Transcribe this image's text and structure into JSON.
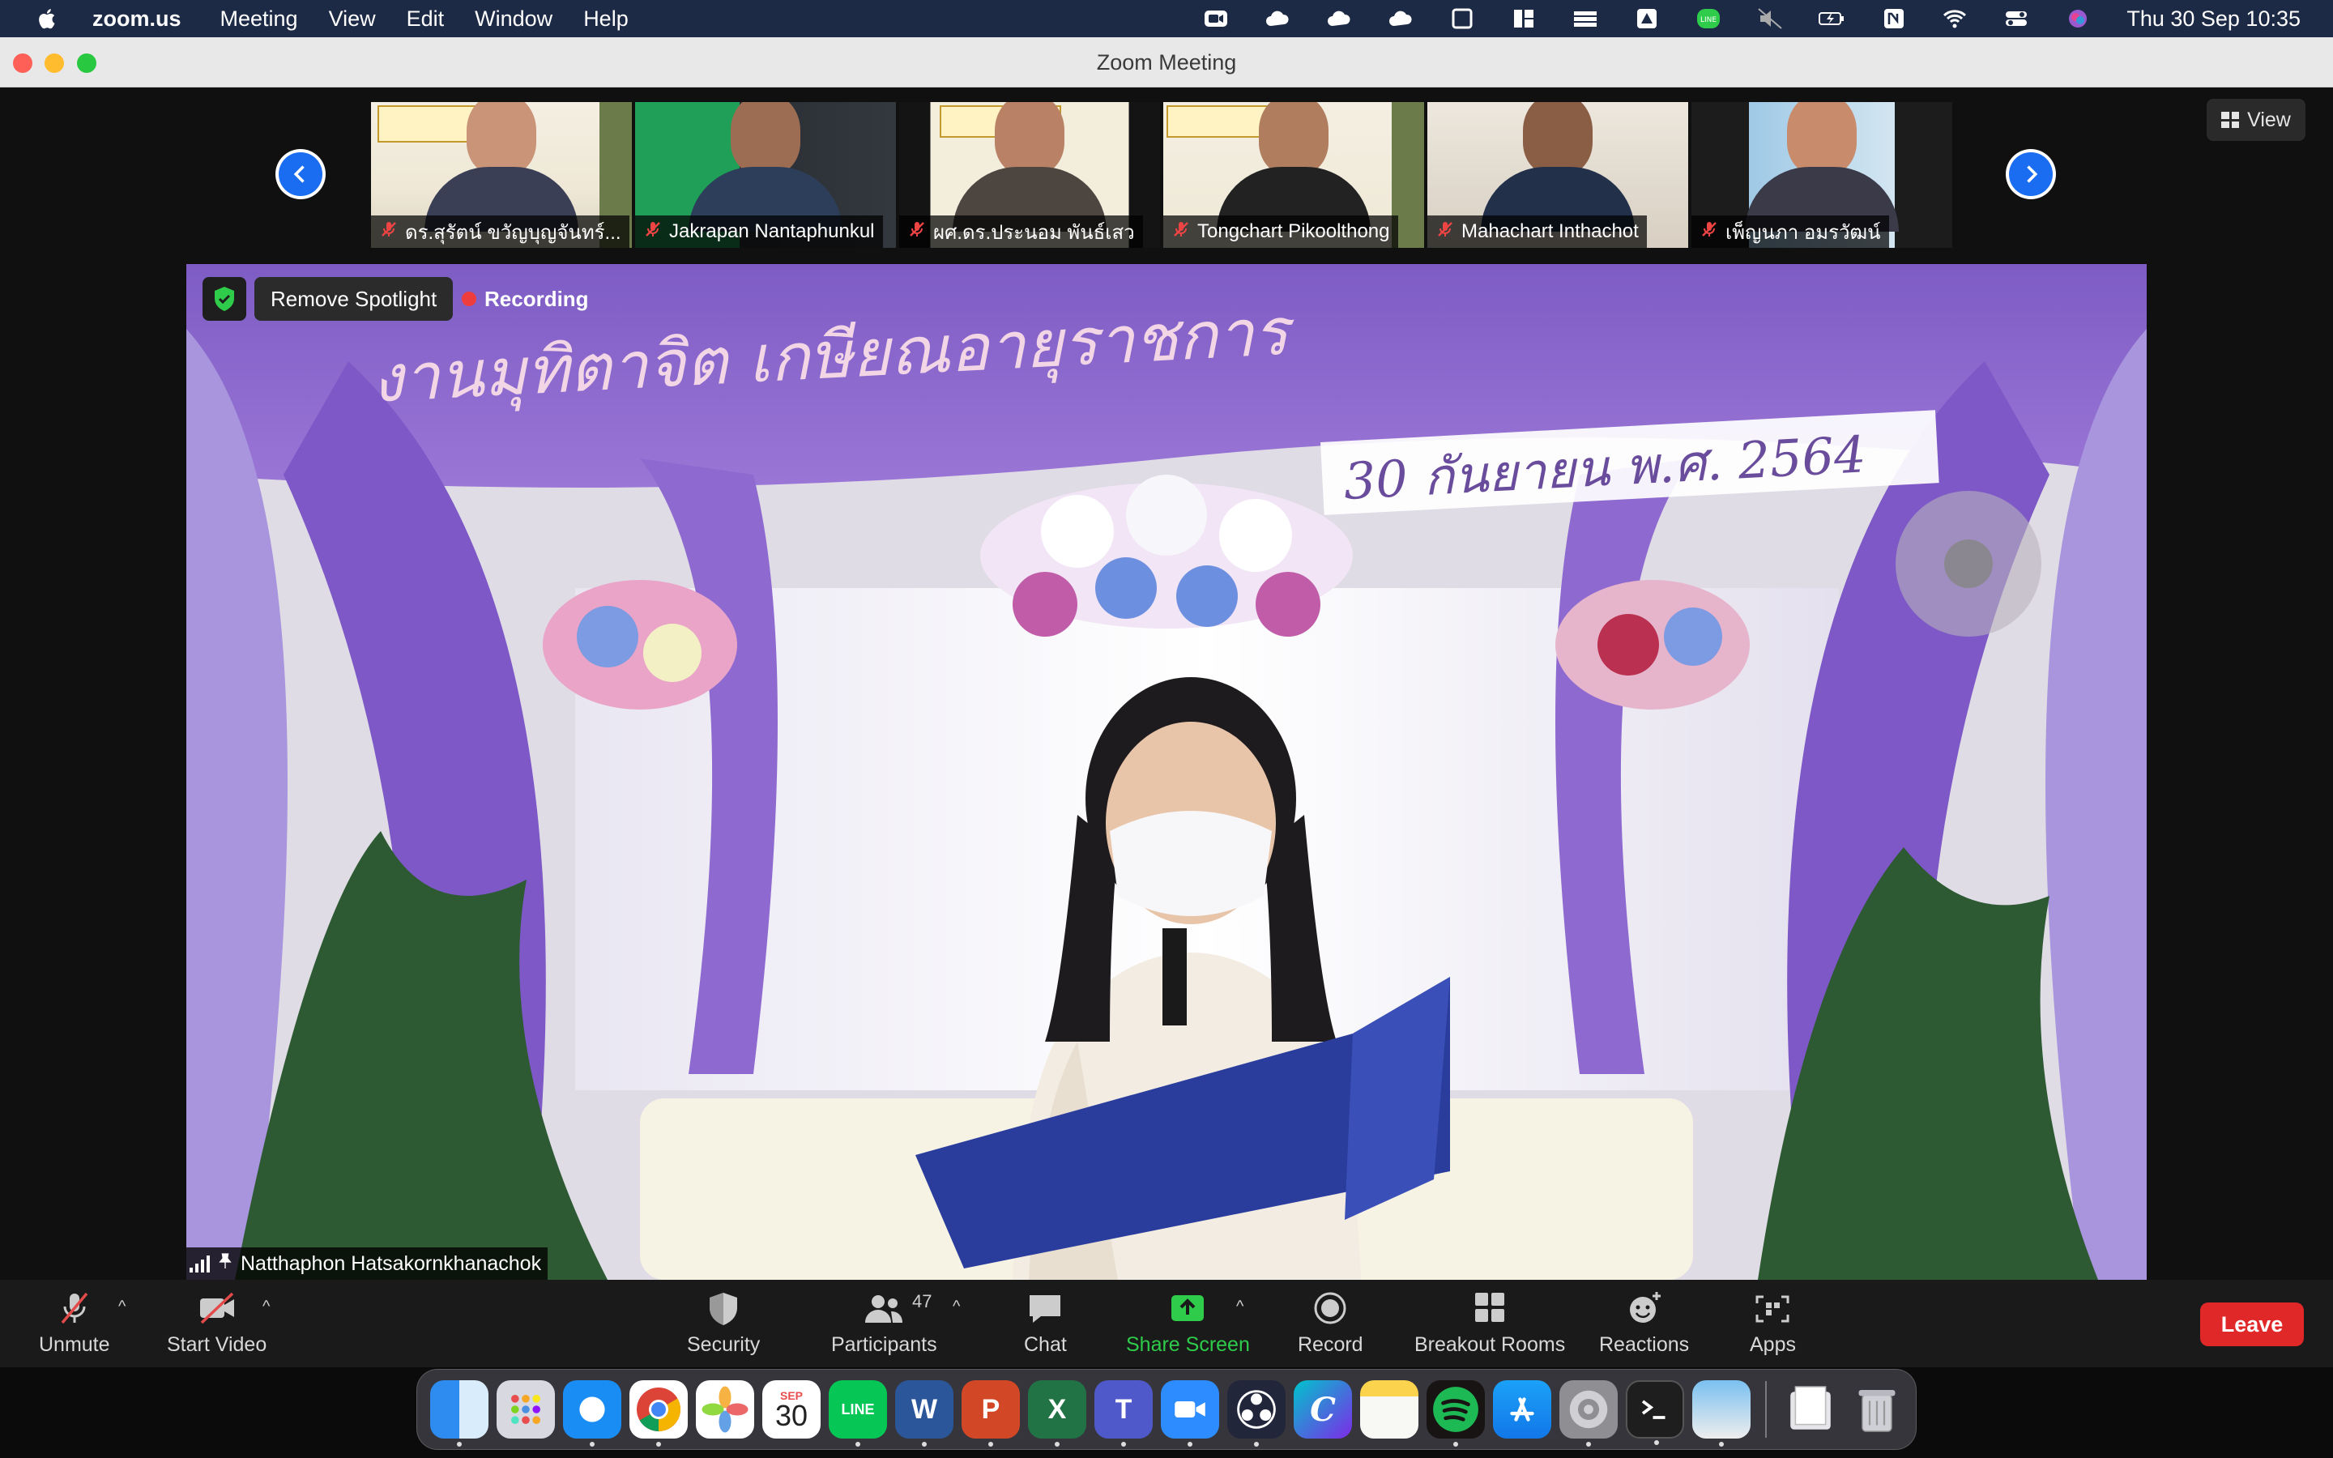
{
  "menubar": {
    "app_name": "zoom.us",
    "items": [
      "Meeting",
      "View",
      "Edit",
      "Window",
      "Help"
    ],
    "clock": "Thu 30 Sep  10:35",
    "line_badge": "LINE"
  },
  "window": {
    "title": "Zoom Meeting"
  },
  "view_button": {
    "label": "View"
  },
  "participants_strip": [
    {
      "name": "ดร.สุรัตน์ ขวัญบุญจันทร์..."
    },
    {
      "name": "Jakrapan Nantaphunkul"
    },
    {
      "name": "ผศ.ดร.ประนอม พันธ์เสว"
    },
    {
      "name": "Tongchart Pikoolthong"
    },
    {
      "name": "Mahachart Inthachot"
    },
    {
      "name": "เพ็ญนภา  อมรวัฒน์"
    }
  ],
  "spotlight": {
    "remove_label": "Remove Spotlight",
    "recording_label": "Recording",
    "speaker_name": "Natthaphon Hatsakornkhanachok",
    "banner_text": "งานมุทิตาจิต เกษียณอายุราชการ",
    "date_text": "30 กันยายน พ.ศ. 2564"
  },
  "toolbar": {
    "unmute": "Unmute",
    "start_video": "Start Video",
    "security": "Security",
    "participants": "Participants",
    "participants_count": "47",
    "chat": "Chat",
    "share_screen": "Share Screen",
    "record": "Record",
    "breakout_rooms": "Breakout Rooms",
    "reactions": "Reactions",
    "apps": "Apps",
    "leave": "Leave"
  },
  "dock": {
    "calendar_month": "SEP",
    "calendar_day": "30",
    "line_label": "LINE",
    "word_label": "W",
    "powerpoint_label": "P",
    "excel_label": "X",
    "teams_label": "T",
    "canva_label": "C"
  },
  "colors": {
    "menubar_bg": "#1c2a45",
    "accent_blue": "#1a6df1",
    "share_green": "#2ecc4a",
    "leave_red": "#e02828",
    "recording_red": "#ee3d3d"
  }
}
